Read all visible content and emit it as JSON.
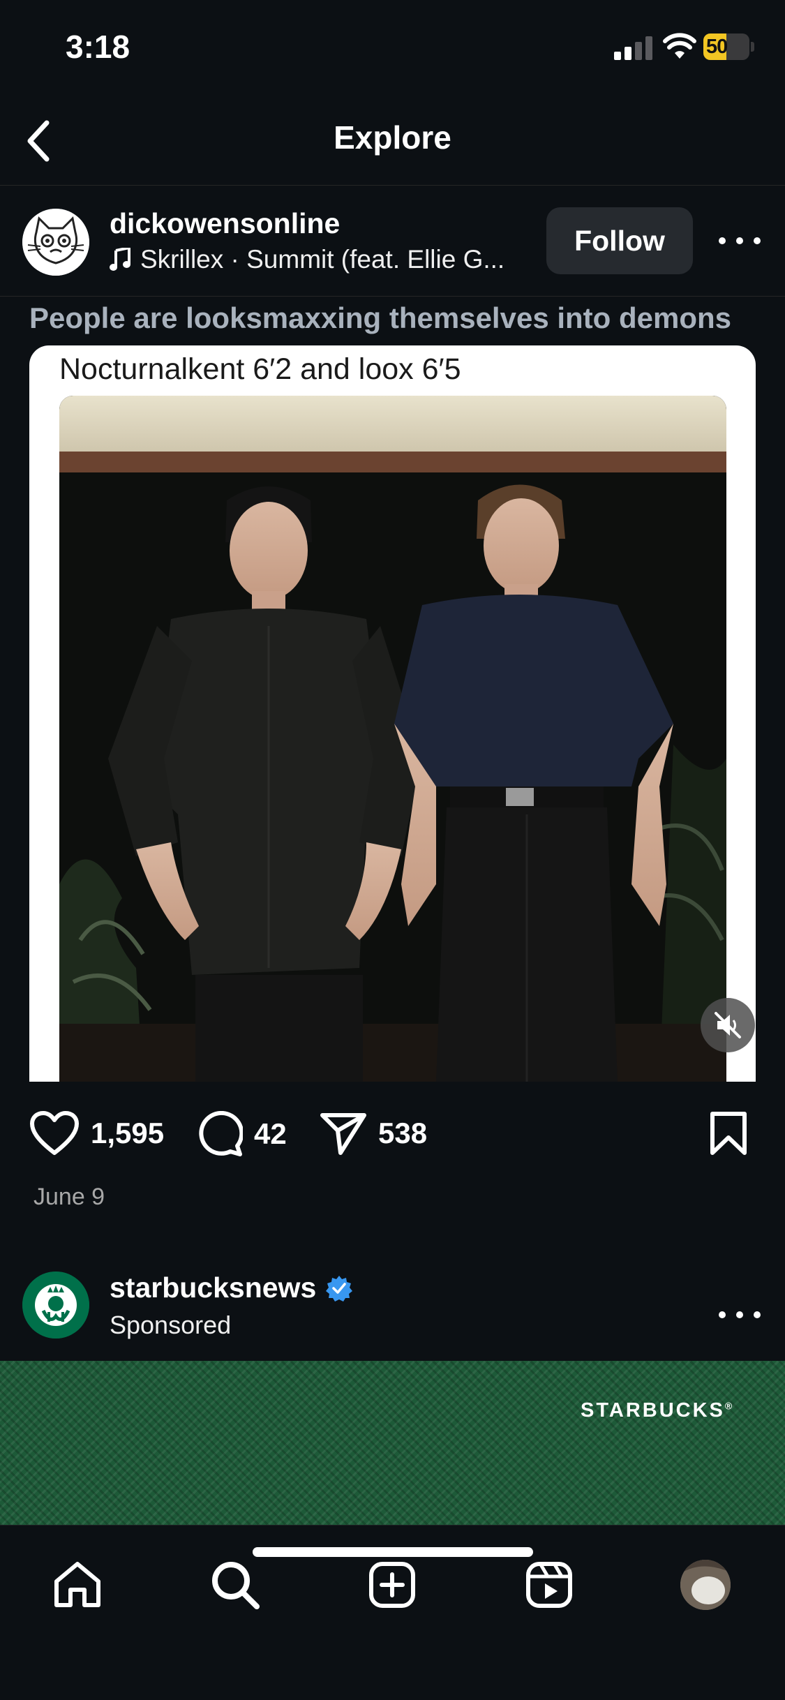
{
  "status_bar": {
    "time": "3:18",
    "battery_percent": "50",
    "battery_level": 0.5
  },
  "header": {
    "title": "Explore",
    "back_icon": "chevron-left-icon"
  },
  "post": {
    "username": "dickowensonline",
    "music": "Skrillex · Summit (feat. Ellie G...",
    "follow_label": "Follow",
    "caption_overlay": "People are looksmaxxing themselves into demons",
    "media_caption": "Nocturnalkent 6′2 and loox 6′5",
    "likes": "1,595",
    "comments": "42",
    "shares": "538",
    "date": "June 9"
  },
  "sponsored": {
    "username": "starbucksnews",
    "verified": true,
    "label": "Sponsored",
    "banner_brand": "STARBUCKS",
    "banner_mark": "®",
    "brand_color": "#00704a"
  },
  "nav": {
    "items": [
      {
        "name": "home",
        "icon": "home-icon"
      },
      {
        "name": "search",
        "icon": "search-icon"
      },
      {
        "name": "create",
        "icon": "plus-square-icon"
      },
      {
        "name": "reels",
        "icon": "reels-icon"
      },
      {
        "name": "profile",
        "icon": "profile-avatar"
      }
    ]
  },
  "colors": {
    "background": "#0c1014",
    "button": "#262a2f",
    "verified": "#3897f0",
    "battery": "#f3c623"
  }
}
